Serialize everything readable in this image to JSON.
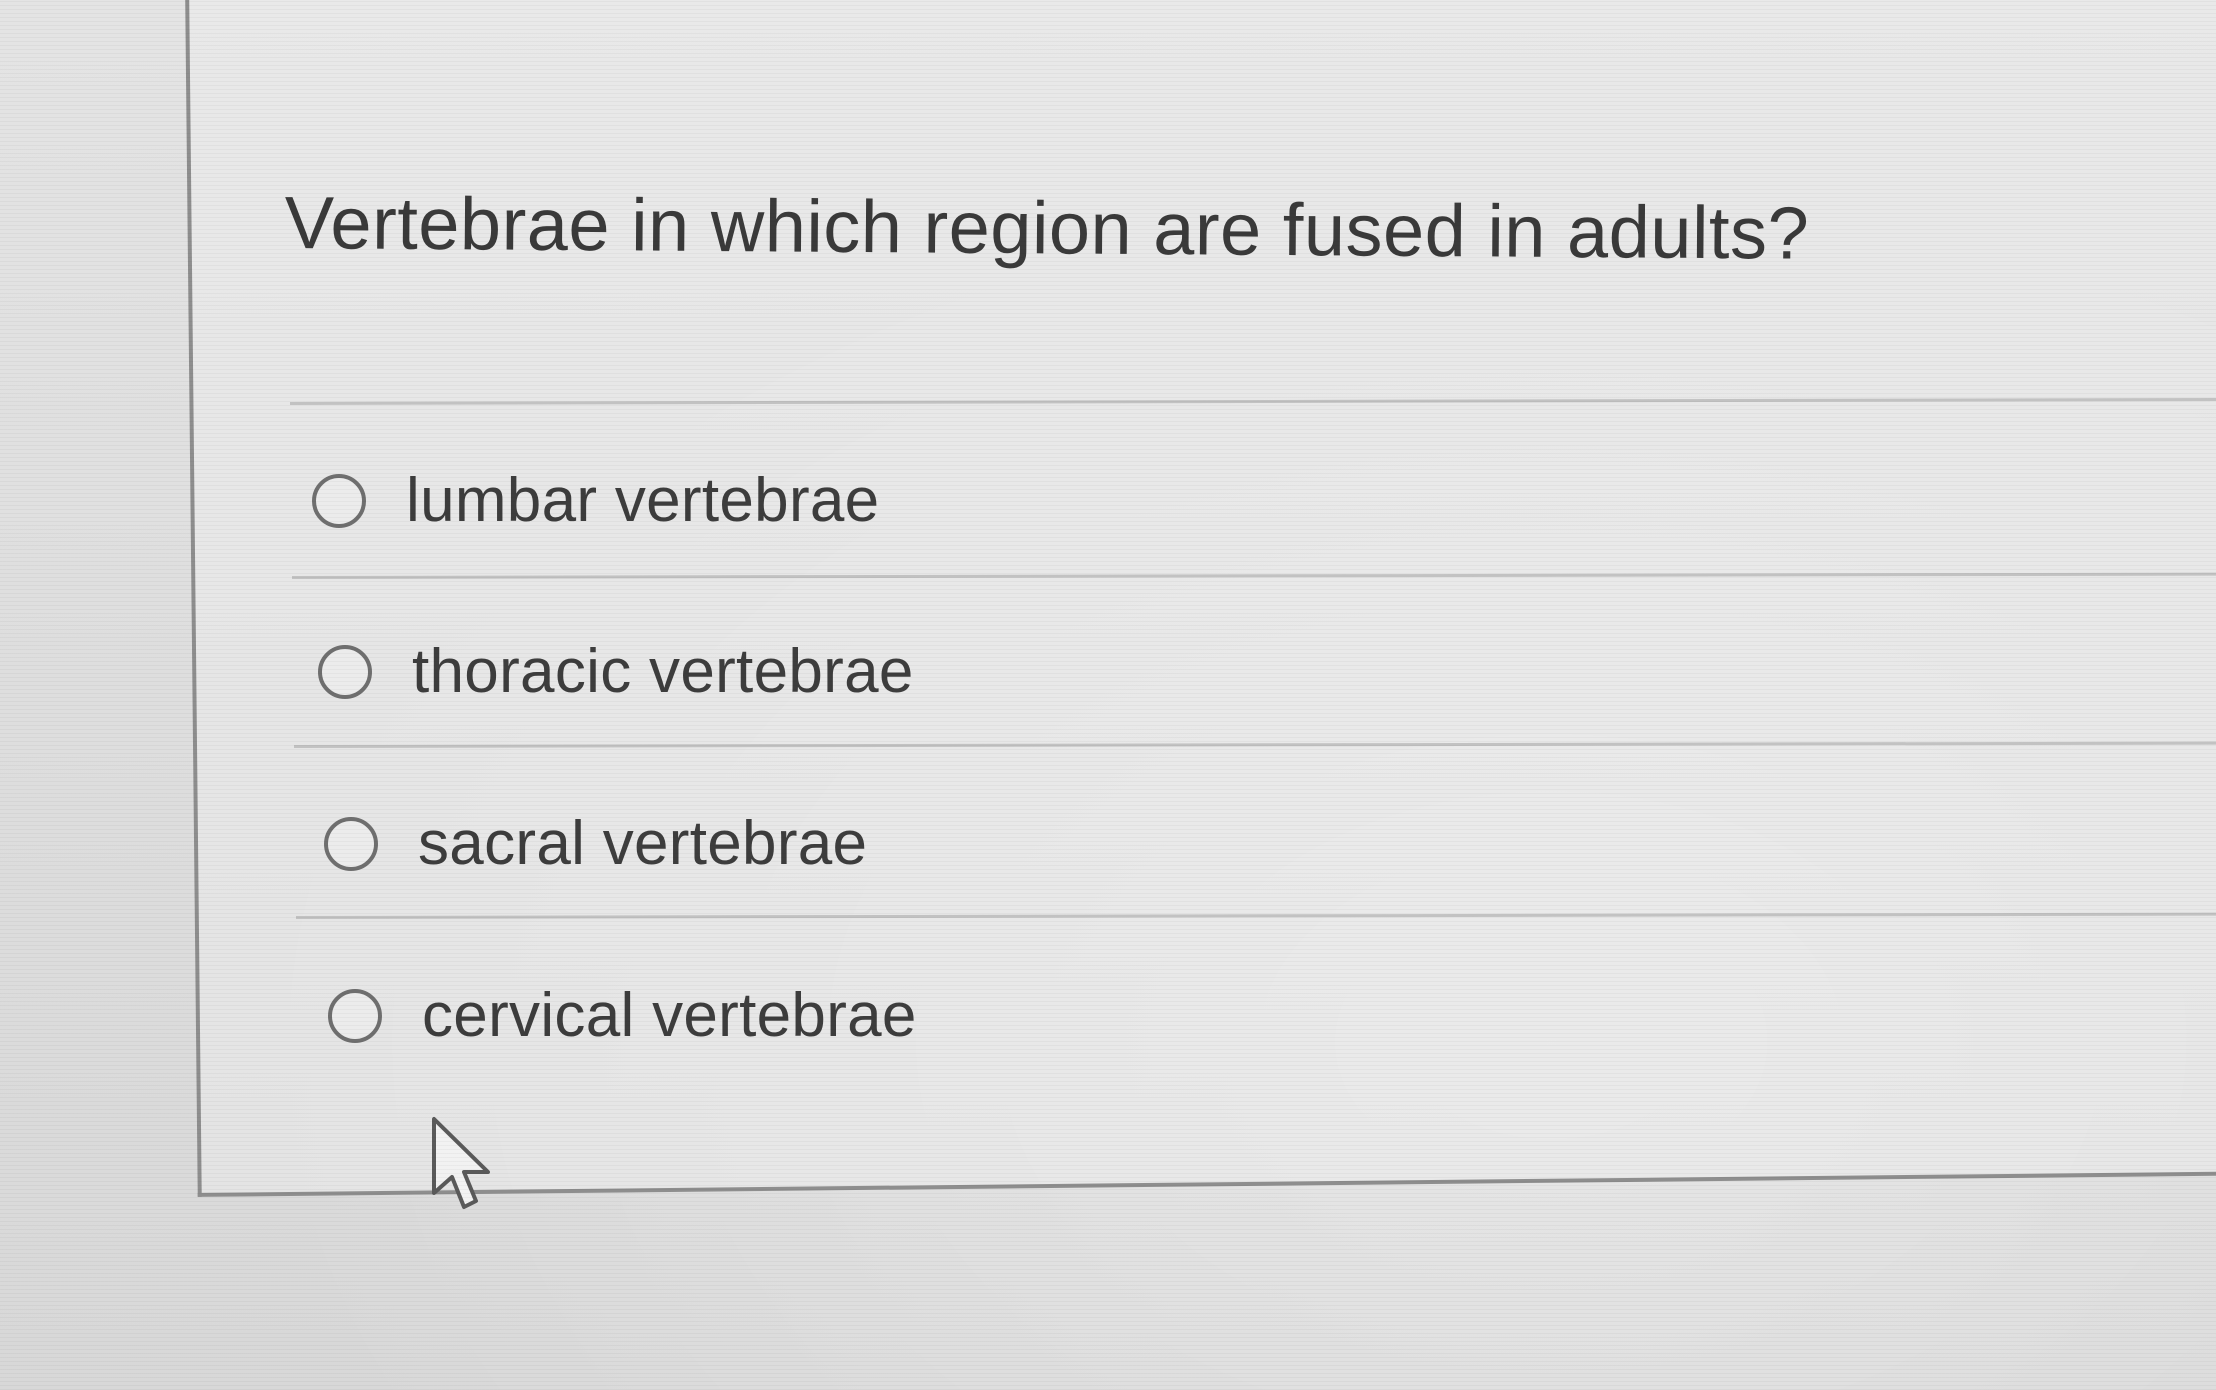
{
  "question": {
    "text": "Vertebrae in which region are fused in adults?"
  },
  "options": [
    {
      "label": "lumbar vertebrae",
      "selected": false
    },
    {
      "label": "thoracic vertebrae",
      "selected": false
    },
    {
      "label": "sacral vertebrae",
      "selected": false
    },
    {
      "label": "cervical vertebrae",
      "selected": false
    }
  ],
  "icons": {
    "radio": "radio-unselected-icon",
    "cursor": "mouse-pointer-icon"
  },
  "colors": {
    "background": "#dedede",
    "text": "#3a3a3a",
    "border": "#8e8e8e",
    "divider": "#c2c2c2"
  }
}
